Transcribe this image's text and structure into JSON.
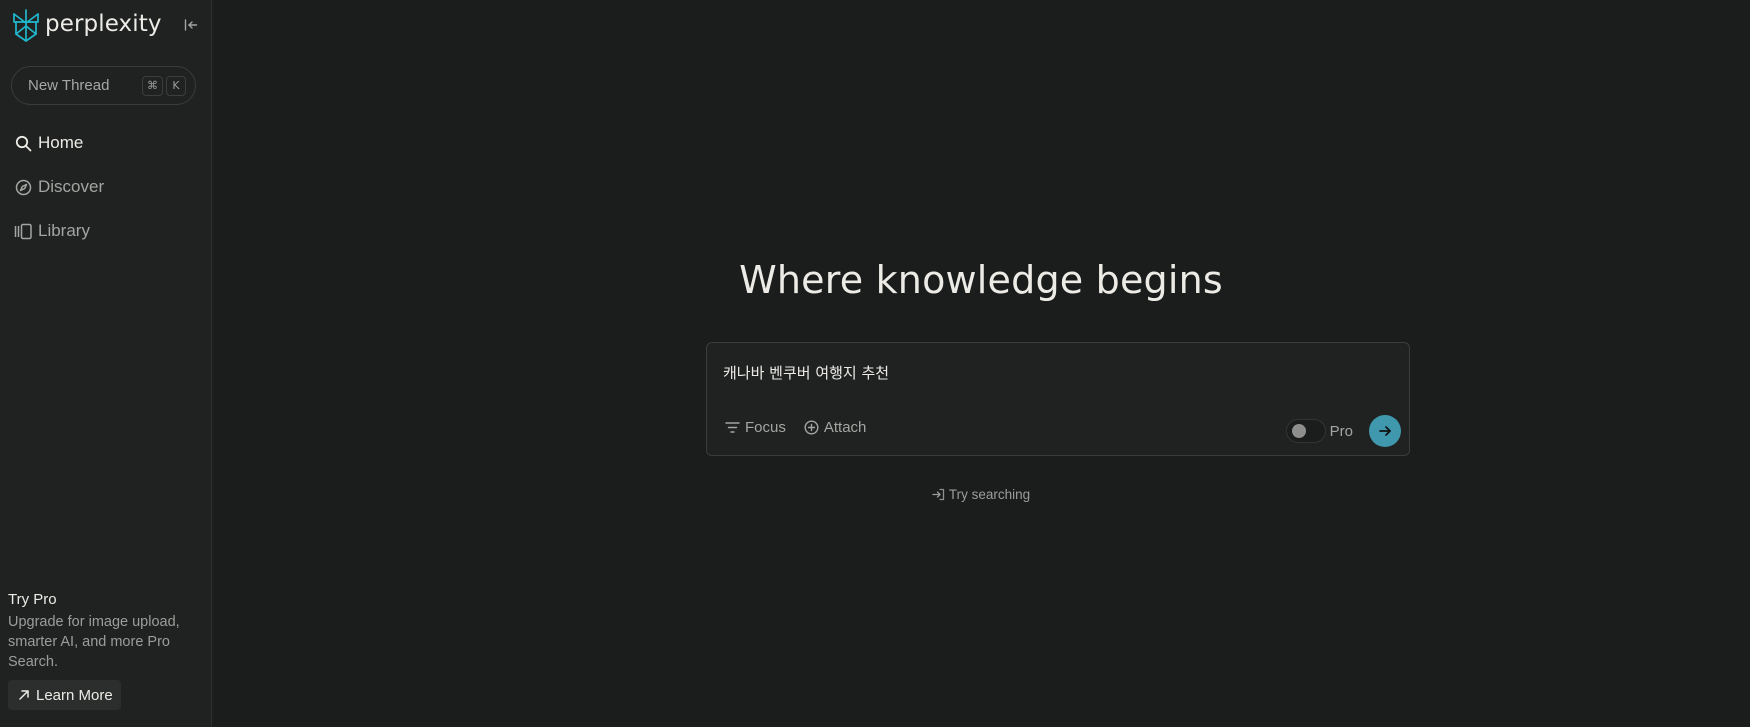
{
  "sidebar": {
    "brand": "perplexity",
    "new_thread": {
      "label": "New Thread",
      "shortcut_keys": [
        "⌘",
        "K"
      ]
    },
    "nav": [
      {
        "label": "Home",
        "icon": "search-icon",
        "active": true
      },
      {
        "label": "Discover",
        "icon": "compass-icon",
        "active": false
      },
      {
        "label": "Library",
        "icon": "library-icon",
        "active": false
      }
    ],
    "promo": {
      "title": "Try Pro",
      "text": "Upgrade for image upload, smarter AI, and more Pro Search.",
      "button": "Learn More"
    }
  },
  "main": {
    "hero": "Where knowledge begins",
    "search": {
      "value": "캐나바 벤쿠버 여행지 추천",
      "focus_label": "Focus",
      "attach_label": "Attach",
      "pro_label": "Pro",
      "pro_enabled": false
    },
    "try_searching": "Try searching"
  },
  "colors": {
    "accent": "#3f98ad",
    "sidebar_bg": "#202222",
    "main_bg": "#1b1c1c",
    "text_primary": "#ecebe6",
    "text_secondary": "#a4a5a2"
  }
}
